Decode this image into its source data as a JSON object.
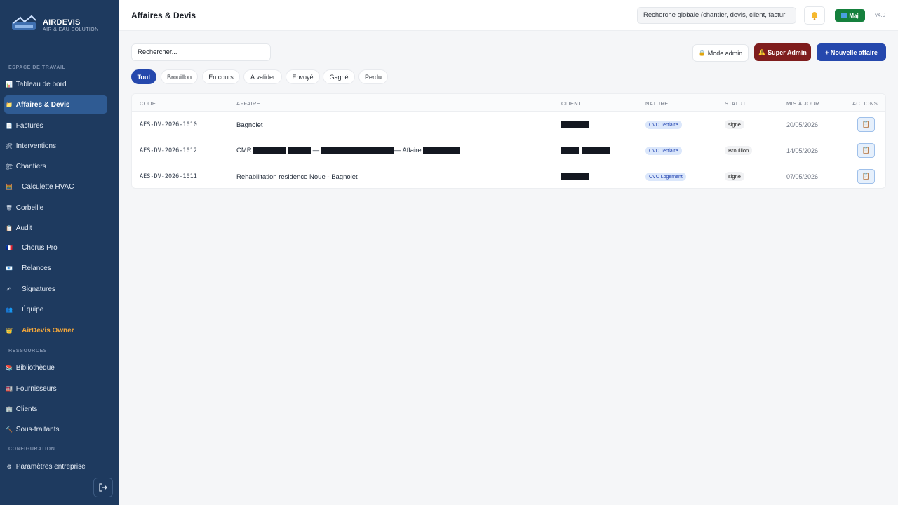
{
  "brand": {
    "name": "AIRDEVIS",
    "subtitle": "AIR & EAU SOLUTION"
  },
  "sidebar": {
    "sections": [
      {
        "label": "ESPACE DE TRAVAIL"
      },
      {
        "label": "RESSOURCES"
      },
      {
        "label": "CONFIGURATION"
      }
    ],
    "items": [
      {
        "label": "Tableau de bord",
        "icon": "chart-icon"
      },
      {
        "label": "Affaires & Devis",
        "icon": "folder-icon",
        "active": true
      },
      {
        "label": "Factures",
        "icon": "document-icon"
      },
      {
        "label": "Interventions",
        "icon": "tools-icon"
      },
      {
        "label": "Chantiers",
        "icon": "site-icon"
      },
      {
        "label": "Calculette HVAC",
        "icon": "calculator-icon"
      },
      {
        "label": "Corbeille",
        "icon": "trash-icon"
      },
      {
        "label": "Audit",
        "icon": "audit-icon"
      },
      {
        "label": "Chorus Pro",
        "icon": "french-flag-icon"
      },
      {
        "label": "Relances",
        "icon": "reminder-icon"
      },
      {
        "label": "Signatures",
        "icon": "signature-icon"
      },
      {
        "label": "Équipe",
        "icon": "team-icon"
      },
      {
        "label": "AirDevis Owner",
        "icon": "crown-icon"
      },
      {
        "label": "Bibliothèque",
        "icon": "books-icon"
      },
      {
        "label": "Fournisseurs",
        "icon": "factory-icon"
      },
      {
        "label": "Clients",
        "icon": "building-icon"
      },
      {
        "label": "Sous-traitants",
        "icon": "hammer-icon"
      },
      {
        "label": "Paramètres entreprise",
        "icon": "gear-icon"
      }
    ]
  },
  "header": {
    "title": "Affaires & Devis",
    "global_search_placeholder": "Recherche globale (chantier, devis, client, factur",
    "maj_label": "Maj",
    "version": "v4.0"
  },
  "toolbar": {
    "search_placeholder": "Rechercher...",
    "mode_admin_label": "Mode admin",
    "super_admin_label": "Super Admin",
    "new_affaire_label": "+ Nouvelle affaire"
  },
  "filters": [
    {
      "label": "Tout",
      "active": true
    },
    {
      "label": "Brouillon"
    },
    {
      "label": "En cours"
    },
    {
      "label": "À valider"
    },
    {
      "label": "Envoyé"
    },
    {
      "label": "Gagné"
    },
    {
      "label": "Perdu"
    }
  ],
  "table": {
    "headers": {
      "code": "CODE",
      "affaire": "AFFAIRE",
      "client": "CLIENT",
      "nature": "NATURE",
      "statut": "STATUT",
      "mis_a_jour": "MIS À JOUR",
      "actions": "ACTIONS"
    },
    "rows": [
      {
        "code": "AES-DV-2026-1010",
        "affaire": "Bagnolet",
        "nature": "CVC Tertiaire",
        "statut": "signe",
        "date": "20/05/2026"
      },
      {
        "code": "AES-DV-2026-1012",
        "affaire_prefix": "CMR",
        "affaire_mid": "—",
        "affaire_suffix": "— Affaire",
        "nature": "CVC Tertiaire",
        "statut": "Brouillon",
        "date": "14/05/2026"
      },
      {
        "code": "AES-DV-2026-1011",
        "affaire": "Rehabilitation residence Noue - Bagnolet",
        "nature": "CVC Logement",
        "statut": "signe",
        "date": "07/05/2026"
      }
    ]
  }
}
